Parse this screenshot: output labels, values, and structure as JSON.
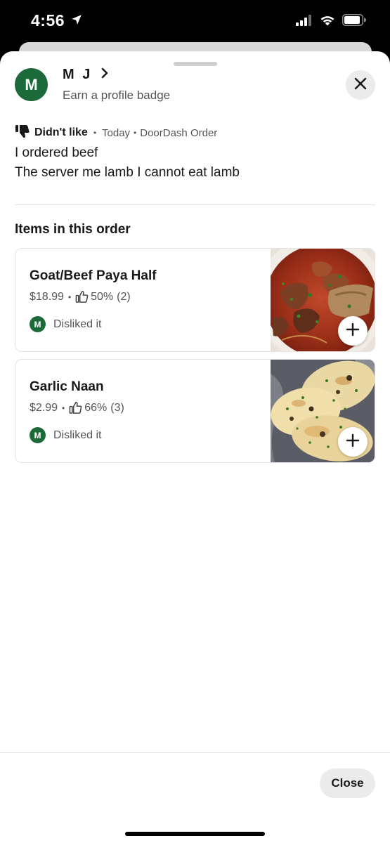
{
  "status_bar": {
    "time": "4:56",
    "icons": [
      "location-arrow-icon",
      "cellular-signal-icon",
      "wifi-icon",
      "battery-icon"
    ]
  },
  "profile": {
    "avatar_letter": "M",
    "name": "M J",
    "subtitle": "Earn a profile badge"
  },
  "review": {
    "rating_label": "Didn't like",
    "rating_icon": "thumbs-down-icon",
    "date": "Today",
    "source": "DoorDash Order",
    "text_lines": [
      "I ordered beef",
      "The server me lamb  I cannot eat lamb"
    ]
  },
  "order": {
    "section_title": "Items in this order",
    "items": [
      {
        "name": "Goat/Beef Paya Half",
        "price": "$18.99",
        "like_percent": "50%",
        "like_count": "(2)",
        "avatar_letter": "M",
        "feedback": "Disliked it",
        "image": "goat-beef-paya-curry-photo"
      },
      {
        "name": "Garlic Naan",
        "price": "$2.99",
        "like_percent": "66%",
        "like_count": "(3)",
        "avatar_letter": "M",
        "feedback": "Disliked it",
        "image": "garlic-naan-photo"
      }
    ]
  },
  "footer": {
    "close_label": "Close"
  },
  "colors": {
    "brand_green": "#1c6a3a",
    "text_primary": "#191919",
    "text_secondary": "#555555",
    "button_gray": "#ebebeb"
  }
}
